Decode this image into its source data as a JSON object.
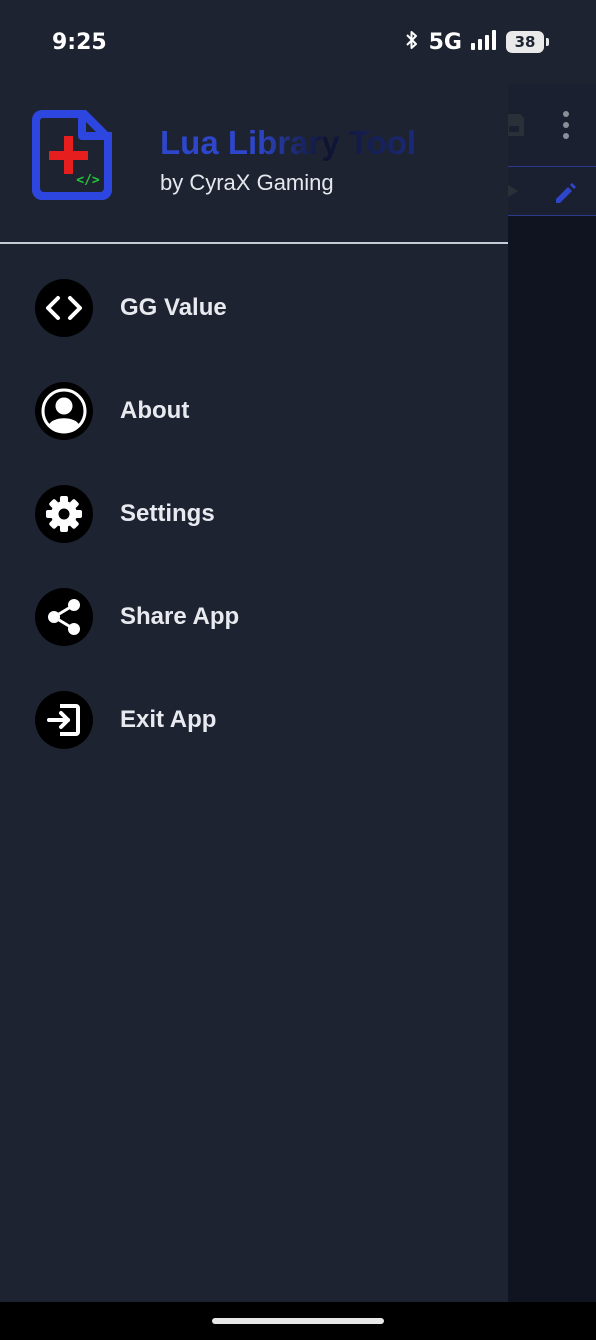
{
  "status_bar": {
    "time": "9:25",
    "network": "5G",
    "battery": "38",
    "icons": [
      "bluetooth-icon",
      "signal-icon",
      "battery-icon"
    ]
  },
  "drawer": {
    "app_title": "Lua Library Tool",
    "app_subtitle": "by CyraX Gaming",
    "logo_icon": "code-file-plus-icon",
    "colors": {
      "background": "#1d2331",
      "accent": "#2e46c9",
      "logo_plus": "#e61e1e",
      "logo_code": "#25c93a"
    },
    "items": [
      {
        "label": "GG Value",
        "icon": "code-brackets-icon"
      },
      {
        "label": "About",
        "icon": "person-icon"
      },
      {
        "label": "Settings",
        "icon": "gear-icon"
      },
      {
        "label": "Share App",
        "icon": "share-icon"
      },
      {
        "label": "Exit App",
        "icon": "exit-icon"
      }
    ]
  },
  "background_app": {
    "icons": [
      "save-icon",
      "more-vert-icon",
      "arrow-right-icon",
      "edit-icon"
    ]
  }
}
